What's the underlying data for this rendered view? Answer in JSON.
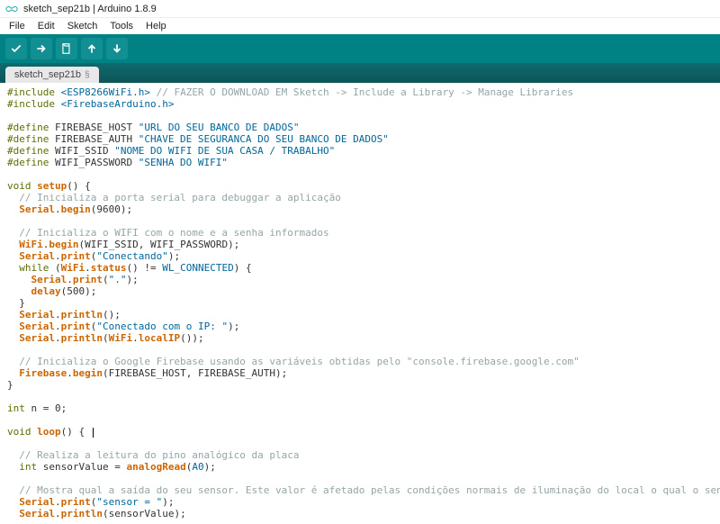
{
  "window": {
    "title": "sketch_sep21b | Arduino 1.8.9"
  },
  "menubar": {
    "items": [
      "File",
      "Edit",
      "Sketch",
      "Tools",
      "Help"
    ]
  },
  "toolbar": {
    "buttons": [
      "verify",
      "upload",
      "new",
      "open",
      "save"
    ]
  },
  "tabs": {
    "active": {
      "name": "sketch_sep21b",
      "modified": "§"
    }
  },
  "code": {
    "lines": [
      {
        "t": "include",
        "header": "<ESP8266WiFi.h>",
        "comment": "// FAZER O DOWNLOAD EM Sketch -> Include a Library -> Manage Libraries"
      },
      {
        "t": "include",
        "header": "<FirebaseArduino.h>"
      },
      {
        "t": "blank"
      },
      {
        "t": "define",
        "name": "FIREBASE_HOST",
        "value": "\"URL DO SEU BANCO DE DADOS\""
      },
      {
        "t": "define",
        "name": "FIREBASE_AUTH",
        "value": "\"CHAVE DE SEGURANCA DO SEU BANCO DE DADOS\""
      },
      {
        "t": "define",
        "name": "WIFI_SSID",
        "value": "\"NOME DO WIFI DE SUA CASA / TRABALHO\""
      },
      {
        "t": "define",
        "name": "WIFI_PASSWORD",
        "value": "\"SENHA DO WIFI\""
      },
      {
        "t": "blank"
      },
      {
        "t": "funcsig",
        "ret": "void",
        "name": "setup",
        "args": "()",
        "open": "{"
      },
      {
        "t": "comment",
        "indent": 2,
        "text": "// Inicializa a porta serial para debuggar a aplicação"
      },
      {
        "t": "call",
        "indent": 2,
        "obj": "Serial",
        "method": "begin",
        "args": "(9600);"
      },
      {
        "t": "blank"
      },
      {
        "t": "comment",
        "indent": 2,
        "text": "// Inicializa o WIFI com o nome e a senha informados"
      },
      {
        "t": "call",
        "indent": 2,
        "obj": "WiFi",
        "method": "begin",
        "args": "(WIFI_SSID, WIFI_PASSWORD);"
      },
      {
        "t": "call",
        "indent": 2,
        "obj": "Serial",
        "method": "print",
        "args_str": "(\"Conectando\");"
      },
      {
        "t": "while",
        "indent": 2,
        "cond_pre": "(",
        "cond_obj": "WiFi",
        "cond_method": "status",
        "cond_post": "() != ",
        "cond_const": "WL_CONNECTED",
        "cond_close": ") {"
      },
      {
        "t": "call",
        "indent": 4,
        "obj": "Serial",
        "method": "print",
        "args_str": "(\".\");"
      },
      {
        "t": "call",
        "indent": 4,
        "obj": null,
        "method": "delay",
        "args": "(500);"
      },
      {
        "t": "close",
        "indent": 2,
        "text": "}"
      },
      {
        "t": "call",
        "indent": 2,
        "obj": "Serial",
        "method": "println",
        "args": "();"
      },
      {
        "t": "call",
        "indent": 2,
        "obj": "Serial",
        "method": "print",
        "args_str": "(\"Conectado com o IP: \");"
      },
      {
        "t": "call_nested",
        "indent": 2,
        "obj": "Serial",
        "method": "println",
        "inner_obj": "WiFi",
        "inner_method": "localIP",
        "tail": "());"
      },
      {
        "t": "blank"
      },
      {
        "t": "comment",
        "indent": 2,
        "text": "// Inicializa o Google Firebase usando as variáveis obtidas pelo \"console.firebase.google.com\""
      },
      {
        "t": "call",
        "indent": 2,
        "obj": "Firebase",
        "method": "begin",
        "args": "(FIREBASE_HOST, FIREBASE_AUTH);"
      },
      {
        "t": "close",
        "indent": 0,
        "text": "}"
      },
      {
        "t": "blank"
      },
      {
        "t": "decl",
        "type": "int",
        "rest": " n = 0;"
      },
      {
        "t": "blank"
      },
      {
        "t": "funcsig_cursor",
        "ret": "void",
        "name": "loop",
        "args": "()",
        "open": " {"
      },
      {
        "t": "blank"
      },
      {
        "t": "comment",
        "indent": 2,
        "text": "// Realiza a leitura do pino analógico da placa"
      },
      {
        "t": "decl_call",
        "indent": 2,
        "type": "int",
        "var": " sensorValue = ",
        "method": "analogRead",
        "arg_const": "A0",
        "tail": ");",
        "open": "("
      },
      {
        "t": "blank"
      },
      {
        "t": "comment",
        "indent": 2,
        "text": "// Mostra qual a saída do seu sensor. Este valor é afetado pelas condições normais de iluminação do local o qual o sensor é posicionado"
      },
      {
        "t": "call",
        "indent": 2,
        "obj": "Serial",
        "method": "print",
        "args_str": "(\"sensor = \");"
      },
      {
        "t": "call",
        "indent": 2,
        "obj": "Serial",
        "method": "println",
        "args": "(sensorValue);"
      }
    ]
  }
}
